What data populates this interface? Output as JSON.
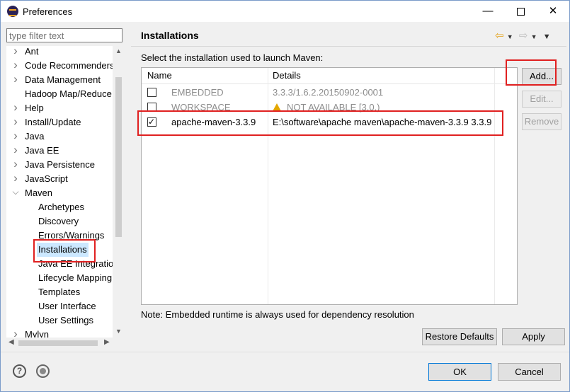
{
  "window": {
    "title": "Preferences"
  },
  "filter": {
    "placeholder": "type filter text"
  },
  "tree": [
    {
      "label": "Ant",
      "expander": "right",
      "indent": 0
    },
    {
      "label": "Code Recommenders",
      "expander": "right",
      "indent": 0
    },
    {
      "label": "Data Management",
      "expander": "right",
      "indent": 0
    },
    {
      "label": "Hadoop Map/Reduce",
      "expander": "none",
      "indent": 0
    },
    {
      "label": "Help",
      "expander": "right",
      "indent": 0
    },
    {
      "label": "Install/Update",
      "expander": "right",
      "indent": 0
    },
    {
      "label": "Java",
      "expander": "right",
      "indent": 0
    },
    {
      "label": "Java EE",
      "expander": "right",
      "indent": 0
    },
    {
      "label": "Java Persistence",
      "expander": "right",
      "indent": 0
    },
    {
      "label": "JavaScript",
      "expander": "right",
      "indent": 0
    },
    {
      "label": "Maven",
      "expander": "down",
      "indent": 0
    },
    {
      "label": "Archetypes",
      "expander": "none",
      "indent": 1
    },
    {
      "label": "Discovery",
      "expander": "none",
      "indent": 1
    },
    {
      "label": "Errors/Warnings",
      "expander": "none",
      "indent": 1
    },
    {
      "label": "Installations",
      "expander": "none",
      "indent": 1,
      "selected": true
    },
    {
      "label": "Java EE Integration",
      "expander": "none",
      "indent": 1
    },
    {
      "label": "Lifecycle Mapping",
      "expander": "none",
      "indent": 1
    },
    {
      "label": "Templates",
      "expander": "none",
      "indent": 1
    },
    {
      "label": "User Interface",
      "expander": "none",
      "indent": 1
    },
    {
      "label": "User Settings",
      "expander": "none",
      "indent": 1
    },
    {
      "label": "Mylyn",
      "expander": "right",
      "indent": 0
    }
  ],
  "page": {
    "title": "Installations",
    "description": "Select the installation used to launch Maven:",
    "table": {
      "headers": [
        "Name",
        "Details"
      ],
      "rows": [
        {
          "name": "EMBEDDED",
          "details": "3.3.3/1.6.2.20150902-0001",
          "checked": false,
          "muted": true,
          "warn": false
        },
        {
          "name": "WORKSPACE",
          "details": "NOT AVAILABLE [3.0,)",
          "checked": false,
          "muted": true,
          "warn": true
        },
        {
          "name": "apache-maven-3.3.9",
          "details": "E:\\software\\apache maven\\apache-maven-3.3.9 3.3.9",
          "checked": true,
          "muted": false,
          "warn": false
        }
      ]
    },
    "buttons": {
      "add": "Add...",
      "edit": "Edit...",
      "remove": "Remove"
    },
    "note": "Note: Embedded runtime is always used for dependency resolution",
    "restore_defaults": "Restore Defaults",
    "apply": "Apply"
  },
  "footer": {
    "ok": "OK",
    "cancel": "Cancel"
  },
  "colors": {
    "highlight": "#e02020",
    "selection": "#cce8ff",
    "focus": "#0078d7"
  }
}
